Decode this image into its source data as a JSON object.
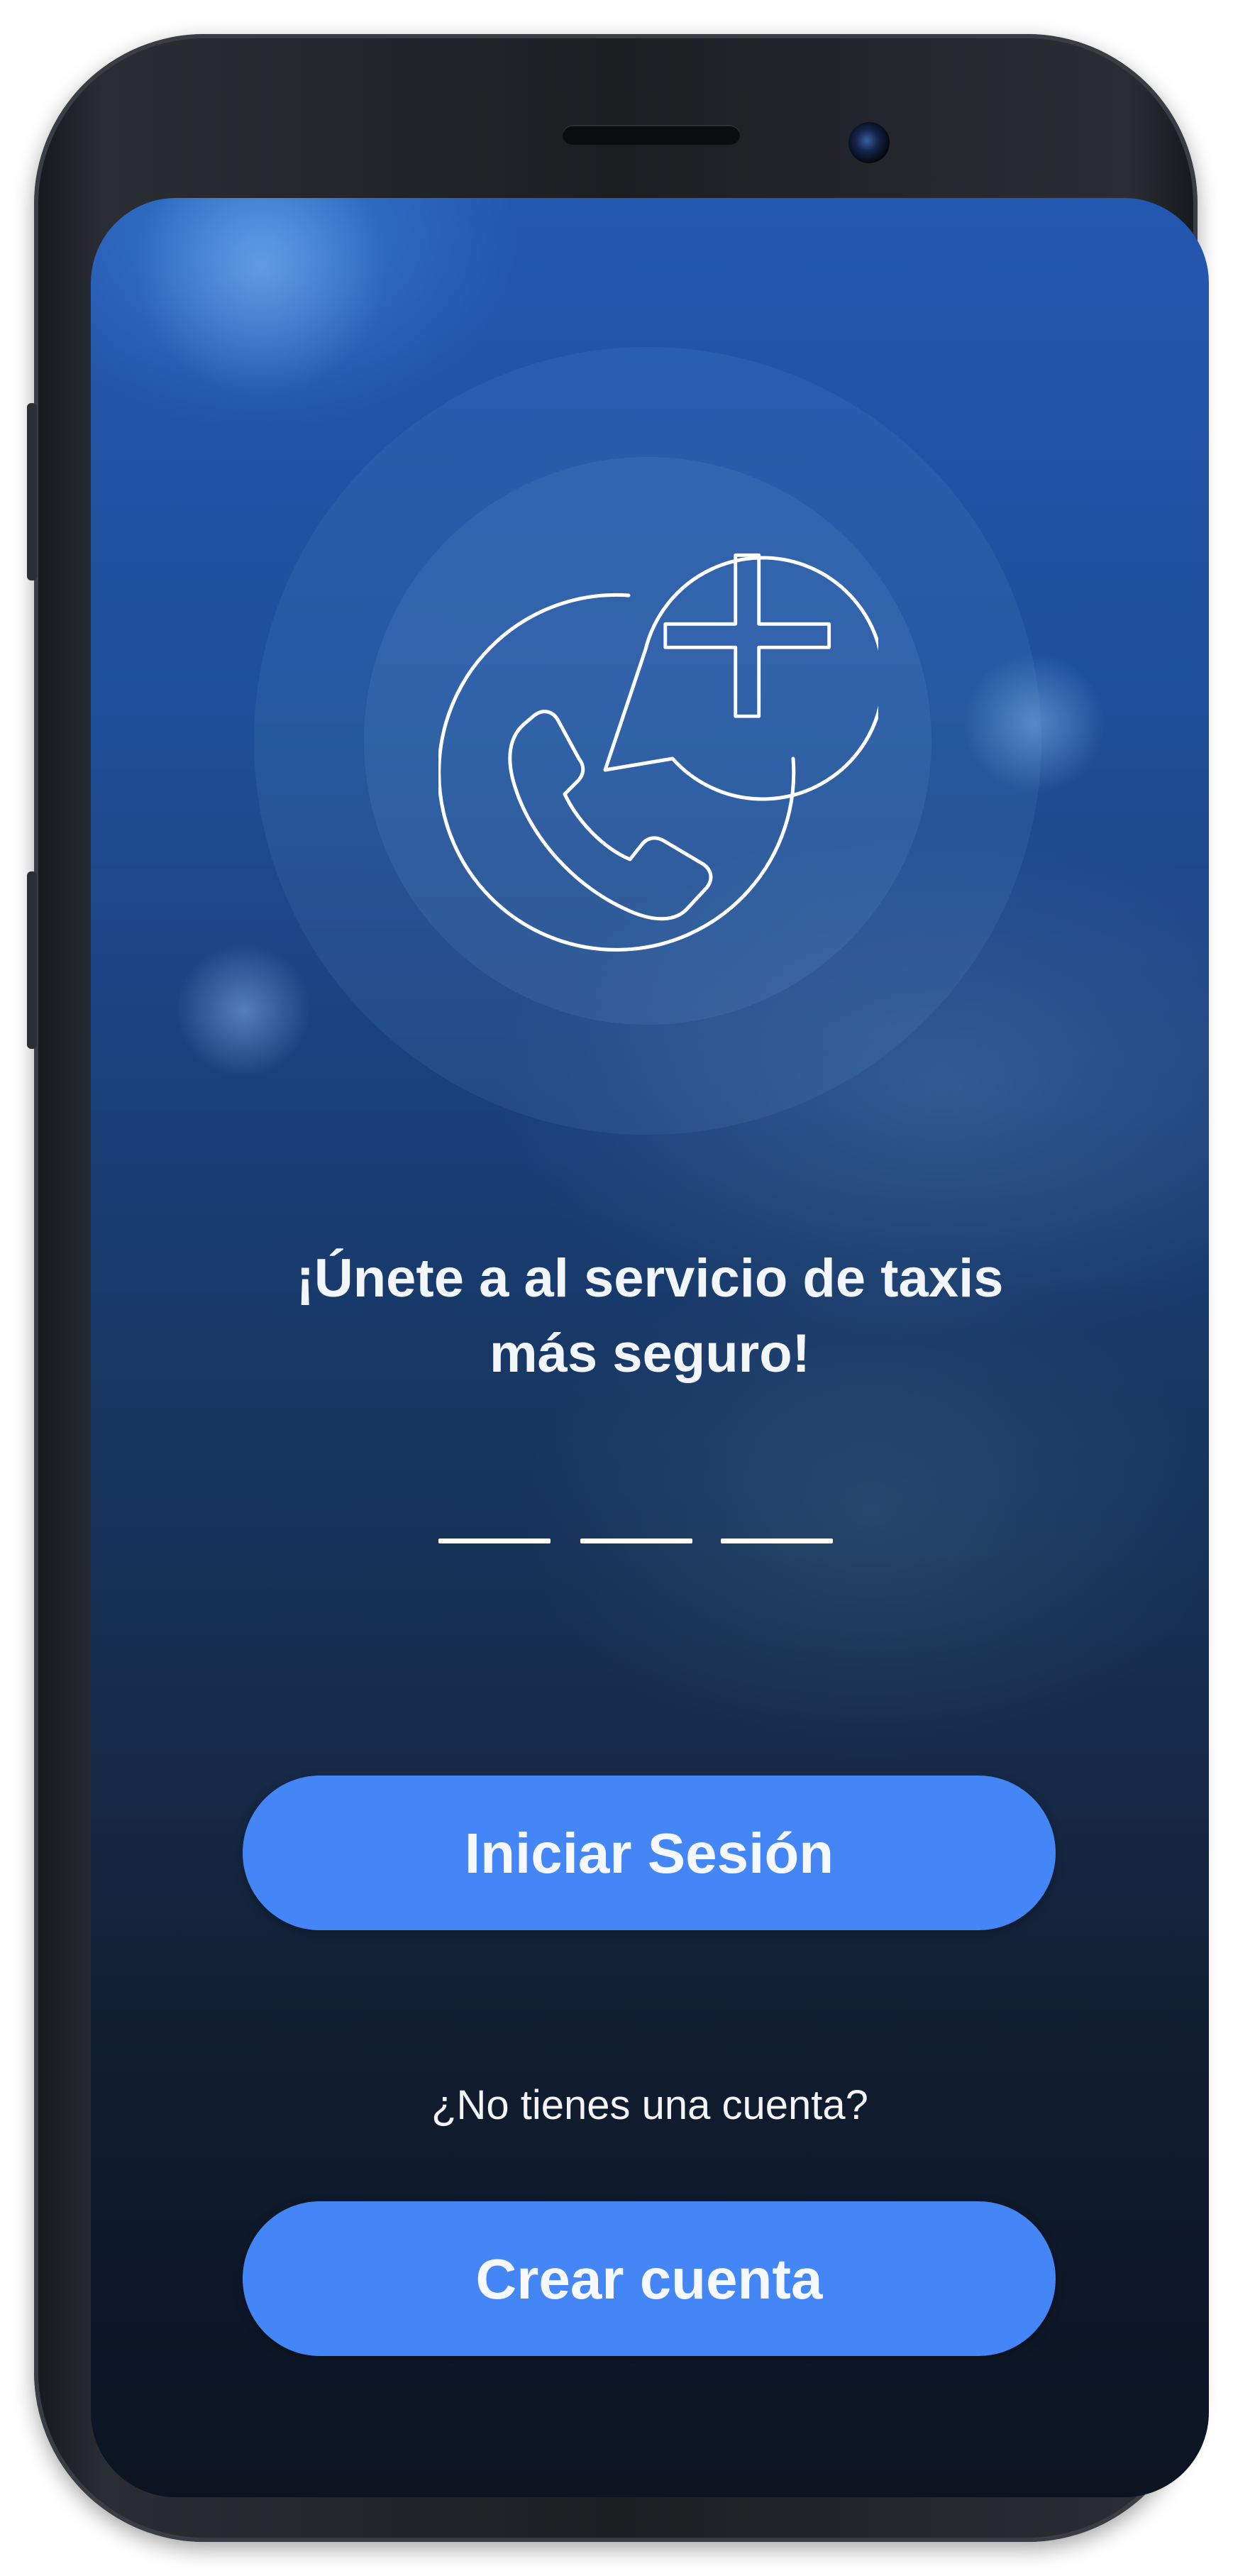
{
  "screen": {
    "headline_line1": "¡Únete a al servicio de taxis",
    "headline_line2": "más seguro!",
    "login_button": "Iniciar Sesión",
    "no_account_text": "¿No tienes una cuenta?",
    "create_account_button": "Crear cuenta"
  },
  "icons": {
    "hero": "phone-add-icon"
  },
  "colors": {
    "button_bg": "#4486f6",
    "text": "#ffffff"
  }
}
